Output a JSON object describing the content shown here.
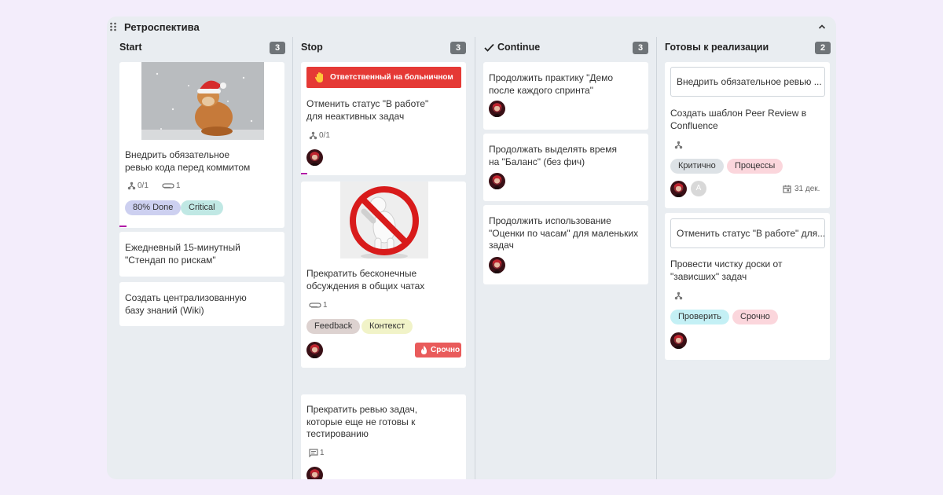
{
  "board": {
    "title": "Ретроспектива"
  },
  "columns": {
    "start": {
      "title": "Start",
      "count": "3",
      "cards": [
        {
          "text": "Внедрить обязательное\nревью кода перед коммитом",
          "subtasks": "0/1",
          "attachments": "1",
          "tags": [
            "80% Done",
            "Critical"
          ]
        },
        {
          "text": "Ежедневный 15-минутный\n\"Стендап по рискам\""
        },
        {
          "text": "Создать централизованную\nбазу знаний (Wiki)"
        }
      ]
    },
    "stop": {
      "title": "Stop",
      "count": "3",
      "cards": [
        {
          "alert": "Ответственный на больничном",
          "text": "Отменить статус \"В работе\"\nдля неактивных задач",
          "subtasks": "0/1"
        },
        {
          "text": "Прекратить бесконечные\nобсуждения в общих чатах",
          "attachments": "1",
          "tags": [
            "Feedback",
            "Контекст"
          ],
          "badge": "Срочно"
        },
        {
          "text": "Прекратить ревью задач,\nкоторые еще не готовы к\nтестированию",
          "comments": "1"
        }
      ]
    },
    "continue": {
      "title": "Continue",
      "count": "3",
      "cards": [
        {
          "text": "Продолжить практику \"Демо\nпосле каждого спринта\""
        },
        {
          "text": "Продолжать выделять время\nна \"Баланс\" (без фич)"
        },
        {
          "text": "Продолжить использование\n\"Оценки по часам\" для маленьких\nзадач"
        }
      ]
    },
    "ready": {
      "title": "Готовы к реализации",
      "count": "2",
      "cards": [
        {
          "subcard": "Внедрить обязательное ревью ...",
          "text": "Создать шаблон Peer Review в\nConfluence",
          "tags": [
            "Критично",
            "Процессы"
          ],
          "avatar_letter": "A",
          "date": "31 дек."
        },
        {
          "subcard": "Отменить статус \"В работе\" для...",
          "text": "Провести чистку доски от\n\"зависших\" задач",
          "tags": [
            "Проверить",
            "Срочно"
          ]
        }
      ]
    }
  },
  "colors": {
    "page_bg": "#f3edfb",
    "board_bg": "#e9edf1",
    "count_badge": "#6f7478",
    "alert": "#e53935",
    "urgent": "#e95b5b",
    "progress": "#b11aa6",
    "tag_80_done": "#cdd0f0",
    "tag_critical": "#c0e8e4",
    "tag_feedback": "#ddd2d0",
    "tag_kontekst": "#f1f3c8",
    "tag_kritichno": "#dde2e6",
    "tag_processy": "#fbd6dc",
    "tag_proverit": "#c4f0f5",
    "tag_srochno": "#fbd6dc"
  },
  "icons": {
    "board": "drag-handle-icon",
    "collapse": "chevron-up-icon",
    "continue": "check-icon",
    "subtasks": "subtasks-icon",
    "attachments": "paperclip-icon",
    "comments": "comment-icon",
    "alert": "hand-icon",
    "urgent": "fire-icon",
    "date": "calendar-icon"
  }
}
